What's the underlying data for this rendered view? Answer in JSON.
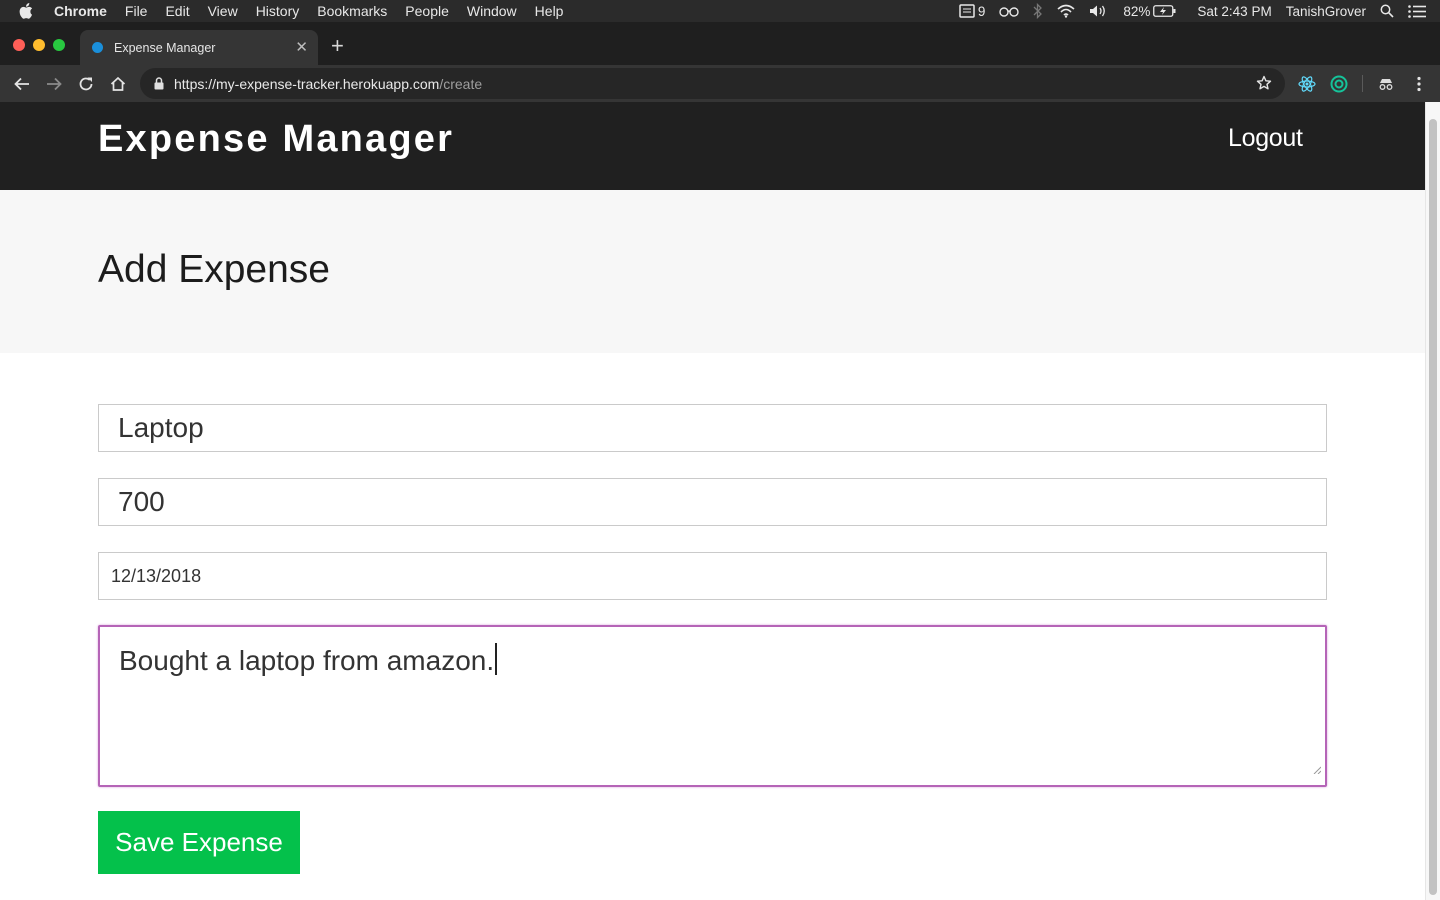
{
  "menubar": {
    "app_name": "Chrome",
    "items": [
      "File",
      "Edit",
      "View",
      "History",
      "Bookmarks",
      "People",
      "Window",
      "Help"
    ],
    "notification_count": "9",
    "battery": "82%",
    "clock": "Sat 2:43 PM",
    "user": "TanishGrover"
  },
  "browser": {
    "tab_title": "Expense Manager",
    "url_host": "https://my-expense-tracker.herokuapp.com",
    "url_path": "/create",
    "accent_favicon": "#1a8fdb"
  },
  "app": {
    "brand": "Expense Manager",
    "logout_label": "Logout",
    "page_title": "Add Expense"
  },
  "form": {
    "description_value": "Laptop",
    "amount_value": "700",
    "date_value": "12/13/2018",
    "note_value": "Bought a laptop from amazon.",
    "save_label": "Save Expense"
  },
  "colors": {
    "header_bg": "#202020",
    "button_green": "#04c14b",
    "focus_border": "#b564b7"
  }
}
